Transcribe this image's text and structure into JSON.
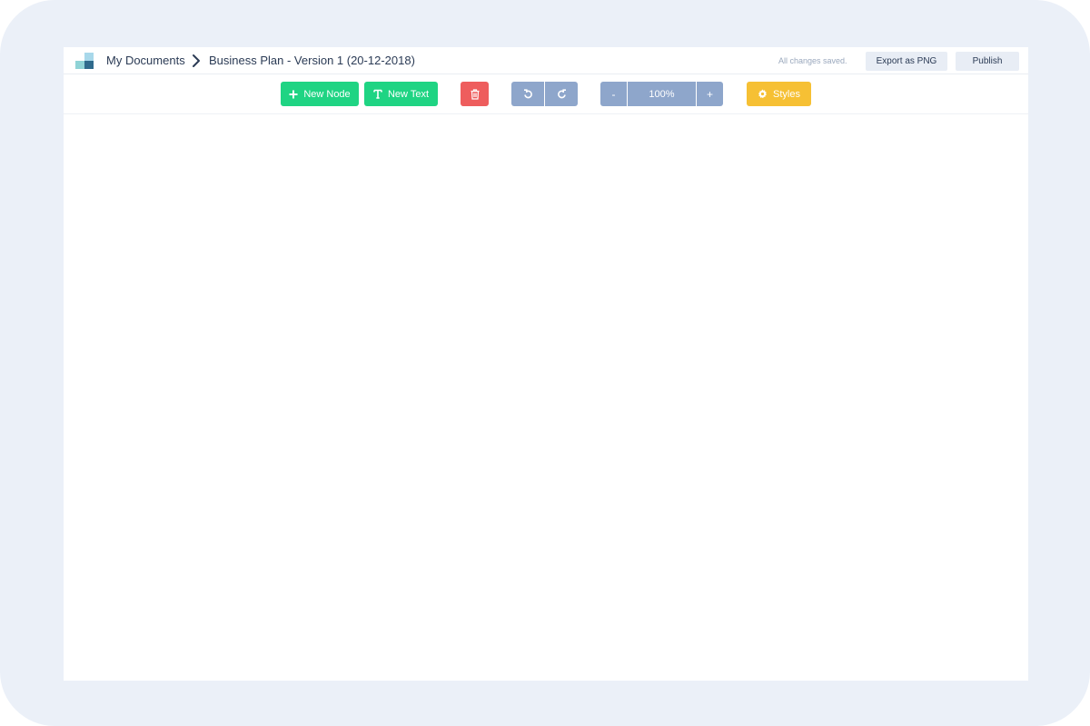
{
  "header": {
    "breadcrumb_root": "My Documents",
    "document_title": "Business Plan - Version 1 (20-12-2018)",
    "save_status": "All changes saved.",
    "export_label": "Export as PNG",
    "publish_label": "Publish"
  },
  "toolbar": {
    "new_node_label": "New Node",
    "new_text_label": "New Text",
    "zoom_out_label": "-",
    "zoom_level": "100%",
    "zoom_in_label": "+",
    "styles_label": "Styles"
  },
  "icons": {
    "logo": "logo-icon",
    "breadcrumb_separator": "chevron-right-icon",
    "new_node": "plus-icon",
    "new_text": "text-icon",
    "delete": "trash-icon",
    "undo": "undo-icon",
    "redo": "redo-icon",
    "styles": "gear-icon"
  },
  "colors": {
    "background": "#ebf0f8",
    "green": "#1fd483",
    "red": "#ee5d5d",
    "blue": "#8ea6cb",
    "yellow": "#f6c034",
    "text": "#2b3b55"
  }
}
